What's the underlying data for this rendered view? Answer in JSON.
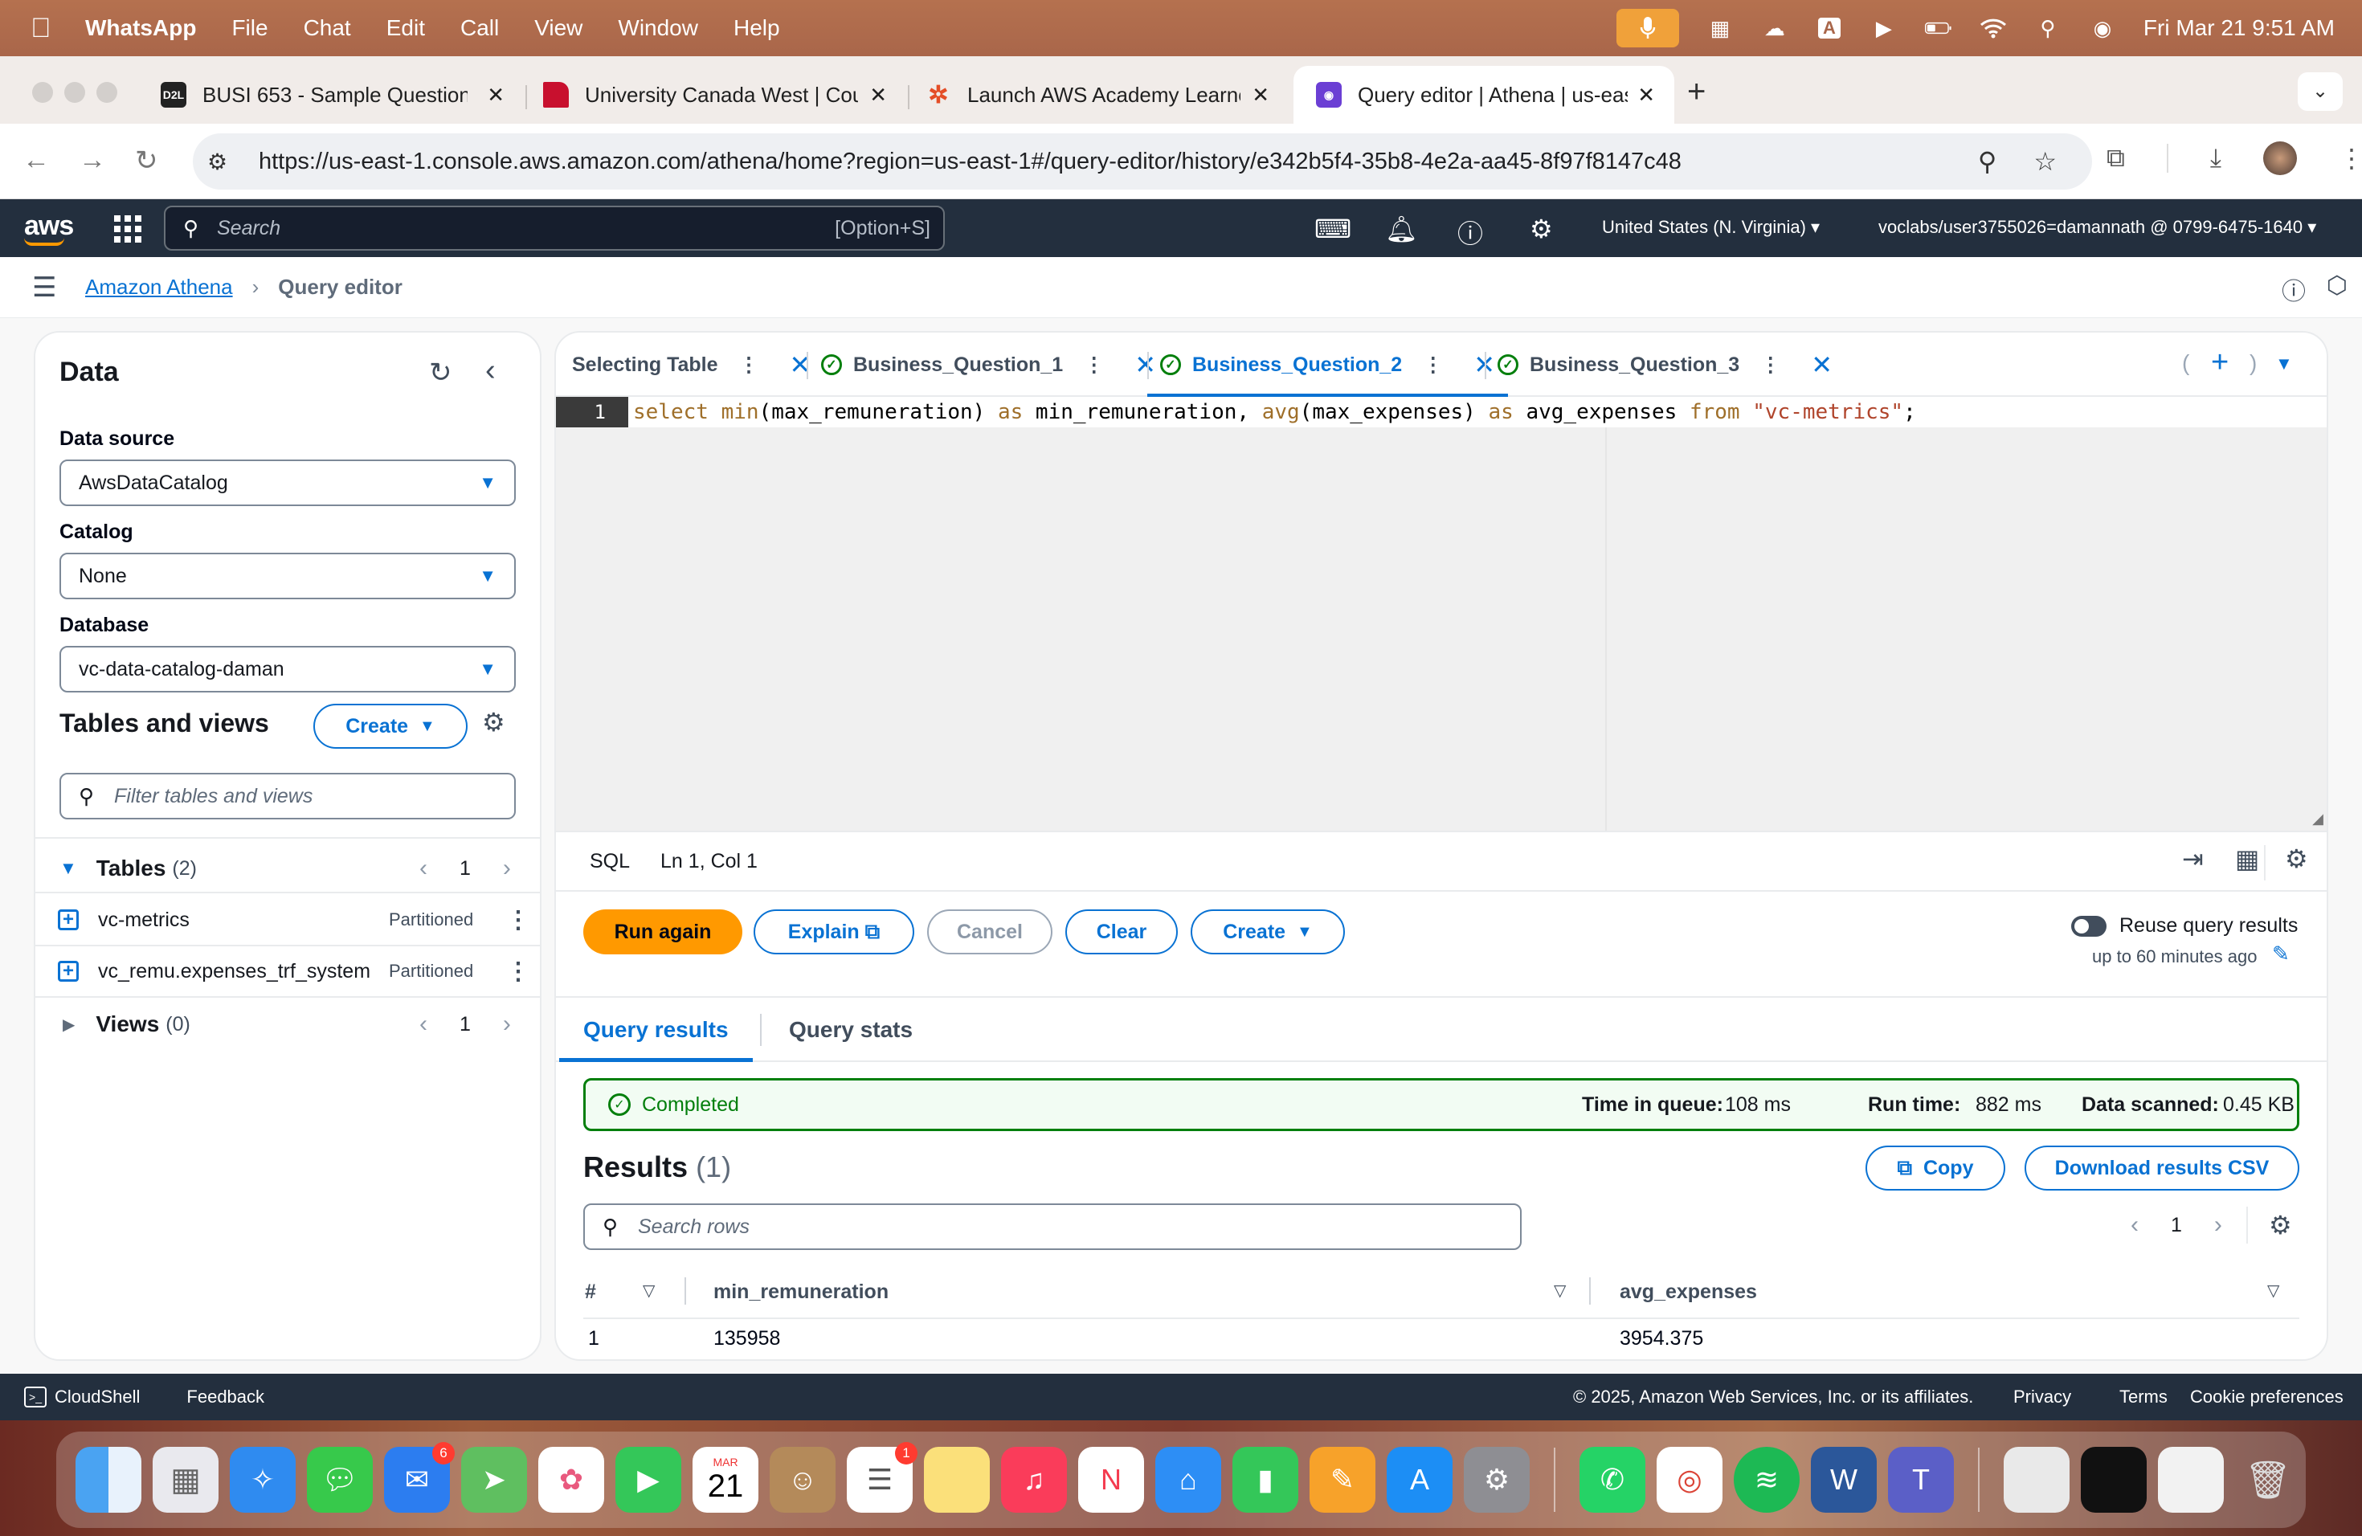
{
  "menubar": {
    "app": "WhatsApp",
    "items": [
      "File",
      "Chat",
      "Edit",
      "Call",
      "View",
      "Window",
      "Help"
    ],
    "datetime": "Fri Mar 21  9:51 AM",
    "input_source": "A"
  },
  "browser": {
    "tabs": [
      {
        "favicon": "D2L",
        "title": "BUSI 653 - Sample Question",
        "color": "#222222"
      },
      {
        "favicon": "",
        "title": "University Canada West | Cou",
        "color": "#c8102e"
      },
      {
        "favicon": "",
        "title": "Launch AWS Academy Learne",
        "color": "#e44d26"
      },
      {
        "favicon": "",
        "title": "Query editor | Athena | us-eas",
        "color": "#6b3fd4"
      }
    ],
    "url": "https://us-east-1.console.aws.amazon.com/athena/home?region=us-east-1#/query-editor/history/e342b5f4-35b8-4e2a-aa45-8f97f8147c48"
  },
  "aws": {
    "logo": "aws",
    "search_placeholder": "Search",
    "search_shortcut": "[Option+S]",
    "region": "United States (N. Virginia)",
    "account": "voclabs/user3755026=damannath @ 0799-6475-1640"
  },
  "breadcrumb": {
    "root": "Amazon Athena",
    "current": "Query editor"
  },
  "left_panel": {
    "title": "Data",
    "data_source_label": "Data source",
    "data_source_value": "AwsDataCatalog",
    "catalog_label": "Catalog",
    "catalog_value": "None",
    "database_label": "Database",
    "database_value": "vc-data-catalog-daman",
    "tables_views_title": "Tables and views",
    "create_label": "Create",
    "filter_placeholder": "Filter tables and views",
    "tables_label": "Tables",
    "tables_count": "(2)",
    "tables_page": "1",
    "tables": [
      {
        "name": "vc-metrics",
        "tag": "Partitioned"
      },
      {
        "name": "vc_remu.expenses_trf_system",
        "tag": "Partitioned"
      }
    ],
    "views_label": "Views",
    "views_count": "(0)",
    "views_page": "1"
  },
  "editor": {
    "tabs": [
      {
        "label": "Selecting Table",
        "status": ""
      },
      {
        "label": "Business_Question_1",
        "status": "ok"
      },
      {
        "label": "Business_Question_2",
        "status": "ok",
        "active": true
      },
      {
        "label": "Business_Question_3",
        "status": "ok"
      }
    ],
    "line_number": "1",
    "query": {
      "kw1": "select",
      "fn1": " min",
      "p1": "(max_remuneration) ",
      "as1": "as",
      "p2": " min_remuneration, ",
      "fn2": "avg",
      "p3": "(max_expenses) ",
      "as2": "as",
      "p4": " avg_expenses ",
      "from": "from",
      "p5": " ",
      "table": "\"vc-metrics\"",
      "end": ";"
    },
    "language": "SQL",
    "cursor": "Ln 1, Col 1",
    "buttons": {
      "run": "Run again",
      "explain": "Explain",
      "cancel": "Cancel",
      "clear": "Clear",
      "create": "Create"
    },
    "reuse_label": "Reuse query results",
    "reuse_sub": "up to 60 minutes ago"
  },
  "results": {
    "tabs": [
      "Query results",
      "Query stats"
    ],
    "status": "Completed",
    "time_in_queue_label": "Time in queue:",
    "time_in_queue": "108 ms",
    "run_time_label": "Run time:",
    "run_time": "882 ms",
    "data_scanned_label": "Data scanned:",
    "data_scanned": "0.45 KB",
    "title": "Results",
    "count": "(1)",
    "copy_label": "Copy",
    "download_label": "Download results CSV",
    "search_placeholder": "Search rows",
    "page": "1",
    "columns": [
      "#",
      "min_remuneration",
      "avg_expenses"
    ],
    "rows": [
      [
        "1",
        "135958",
        "3954.375"
      ]
    ]
  },
  "footer": {
    "cloudshell": "CloudShell",
    "feedback": "Feedback",
    "copyright": "© 2025, Amazon Web Services, Inc. or its affiliates.",
    "privacy": "Privacy",
    "terms": "Terms",
    "cookies": "Cookie preferences"
  },
  "dock": {
    "mail_badge": "6",
    "reminders_badge": "1",
    "calendar_month": "MAR",
    "calendar_day": "21"
  },
  "colors": {
    "aws_nav": "#232f3e",
    "accent": "#0972d3",
    "run": "#ff9900",
    "success": "#037f0c"
  }
}
